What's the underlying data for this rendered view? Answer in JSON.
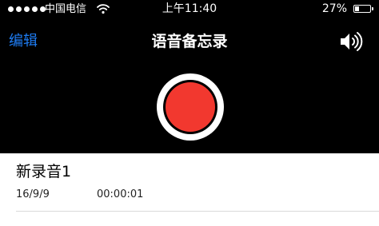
{
  "status_bar": {
    "carrier": "中国电信",
    "time": "上午11:40",
    "battery_percent": "27%",
    "battery_level": 0.27,
    "signal_strength": 5
  },
  "nav": {
    "edit_label": "编辑",
    "title": "语音备忘录",
    "speaker_icon": "speaker-icon"
  },
  "recordings": [
    {
      "name": "新录音1",
      "date": "16/9/9",
      "duration": "00:00:01"
    }
  ],
  "colors": {
    "accent": "#1e7cf2",
    "record": "#f2382f",
    "background": "#000000",
    "list_background": "#ffffff"
  }
}
